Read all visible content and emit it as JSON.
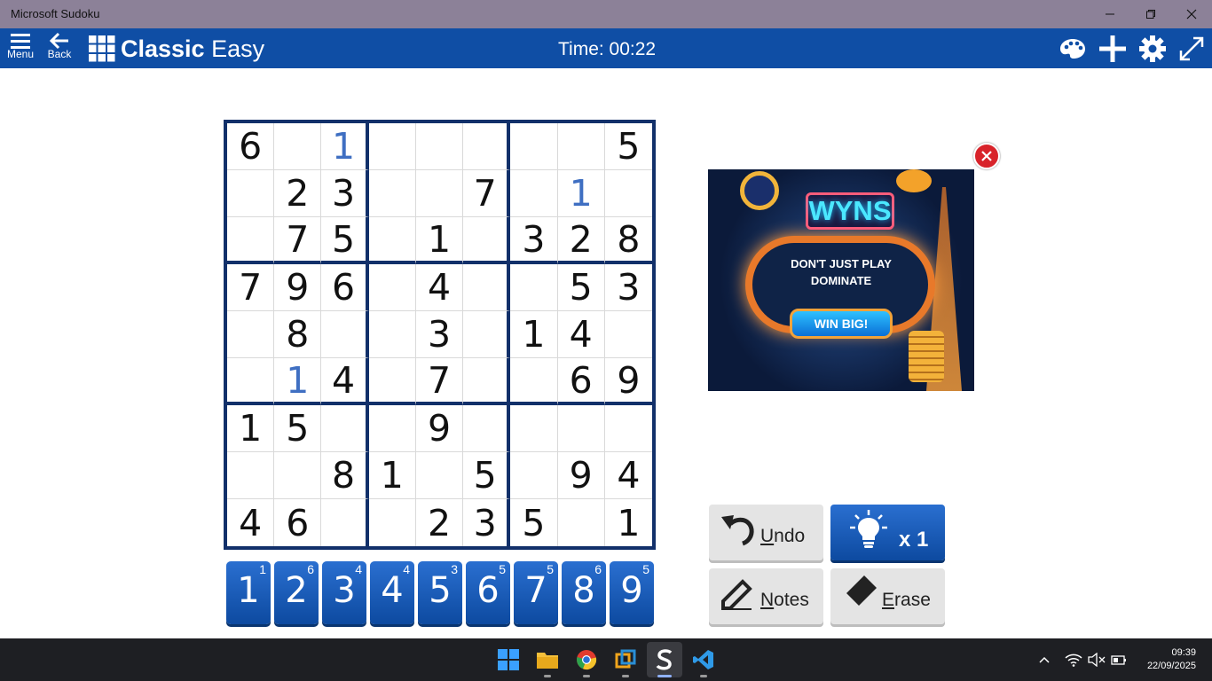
{
  "window": {
    "title": "Microsoft Sudoku"
  },
  "appbar": {
    "menu_label": "Menu",
    "back_label": "Back",
    "game_mode": "Classic",
    "difficulty": "Easy",
    "timer": "Time: 00:22"
  },
  "board": {
    "cells": [
      [
        "6",
        "",
        "1",
        "",
        "",
        "",
        "",
        "",
        "5"
      ],
      [
        "",
        "2",
        "3",
        "",
        "",
        "7",
        "",
        "1",
        ""
      ],
      [
        "",
        "7",
        "5",
        "",
        "1",
        "",
        "3",
        "2",
        "8"
      ],
      [
        "7",
        "9",
        "6",
        "",
        "4",
        "",
        "",
        "5",
        "3"
      ],
      [
        "",
        "8",
        "",
        "",
        "3",
        "",
        "1",
        "4",
        ""
      ],
      [
        "",
        "1",
        "4",
        "",
        "7",
        "",
        "",
        "6",
        "9"
      ],
      [
        "1",
        "5",
        "",
        "",
        "9",
        "",
        "",
        "",
        ""
      ],
      [
        "",
        "",
        "8",
        "1",
        "",
        "5",
        "",
        "9",
        "4"
      ],
      [
        "4",
        "6",
        "",
        "",
        "2",
        "3",
        "5",
        "",
        "1"
      ]
    ],
    "user_entered": [
      [
        0,
        2
      ],
      [
        1,
        7
      ],
      [
        5,
        1
      ]
    ],
    "given_color": "#111111",
    "user_color": "#3f6fc2"
  },
  "numpad": [
    {
      "digit": "1",
      "remaining": "1"
    },
    {
      "digit": "2",
      "remaining": "6"
    },
    {
      "digit": "3",
      "remaining": "4"
    },
    {
      "digit": "4",
      "remaining": "4"
    },
    {
      "digit": "5",
      "remaining": "3"
    },
    {
      "digit": "6",
      "remaining": "5"
    },
    {
      "digit": "7",
      "remaining": "5"
    },
    {
      "digit": "8",
      "remaining": "6"
    },
    {
      "digit": "9",
      "remaining": "5"
    }
  ],
  "ad": {
    "brand": "WYNS",
    "line1": "DON'T JUST PLAY",
    "line2": "DOMINATE",
    "cta": "WIN BIG!"
  },
  "actions": {
    "undo": {
      "first": "U",
      "rest": "ndo"
    },
    "hint": {
      "count": "x 1"
    },
    "notes": {
      "first": "N",
      "rest": "otes"
    },
    "erase": {
      "first": "E",
      "rest": "rase"
    }
  },
  "taskbar": {
    "time": "09:39",
    "date": "22/09/2025"
  },
  "colors": {
    "appbar": "#0f4ea5",
    "titlebar": "#8c8198",
    "accent": "#0d4aa0",
    "board_border": "#12306a"
  }
}
